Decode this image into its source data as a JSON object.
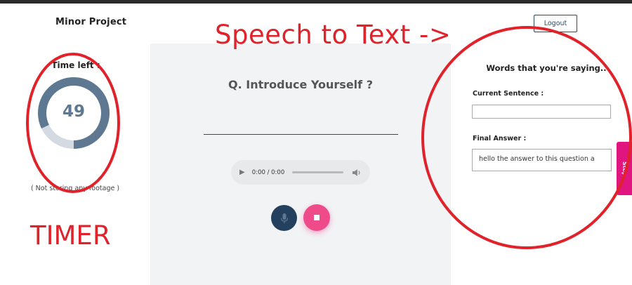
{
  "header": {
    "brand": "Minor Project",
    "logout_label": "Logout"
  },
  "annotations": {
    "speech_label": "Speech to Text ->",
    "timer_label": "TIMER",
    "color": "#e0222b"
  },
  "timer": {
    "label": "Time left :",
    "value": "49",
    "fraction_remaining": 0.82,
    "ring_color": "#5d7890",
    "track_color": "#d3dae1",
    "note": "( Not storing any footage )"
  },
  "question": {
    "text": "Q. Introduce Yourself ?"
  },
  "audio": {
    "time": "0:00 / 0:00"
  },
  "controls": {
    "mic_icon": "microphone-icon",
    "stop_icon": "stop-icon",
    "mic_color": "#23405f",
    "stop_color": "#ef4a8a"
  },
  "speech_panel": {
    "title": "Words that you're saying..",
    "current_label": "Current Sentence :",
    "current_value": "",
    "final_label": "Final Answer :",
    "final_value": "hello the answer to this question a"
  },
  "side_tab": {
    "label": "Stop",
    "color": "#e0157f"
  }
}
